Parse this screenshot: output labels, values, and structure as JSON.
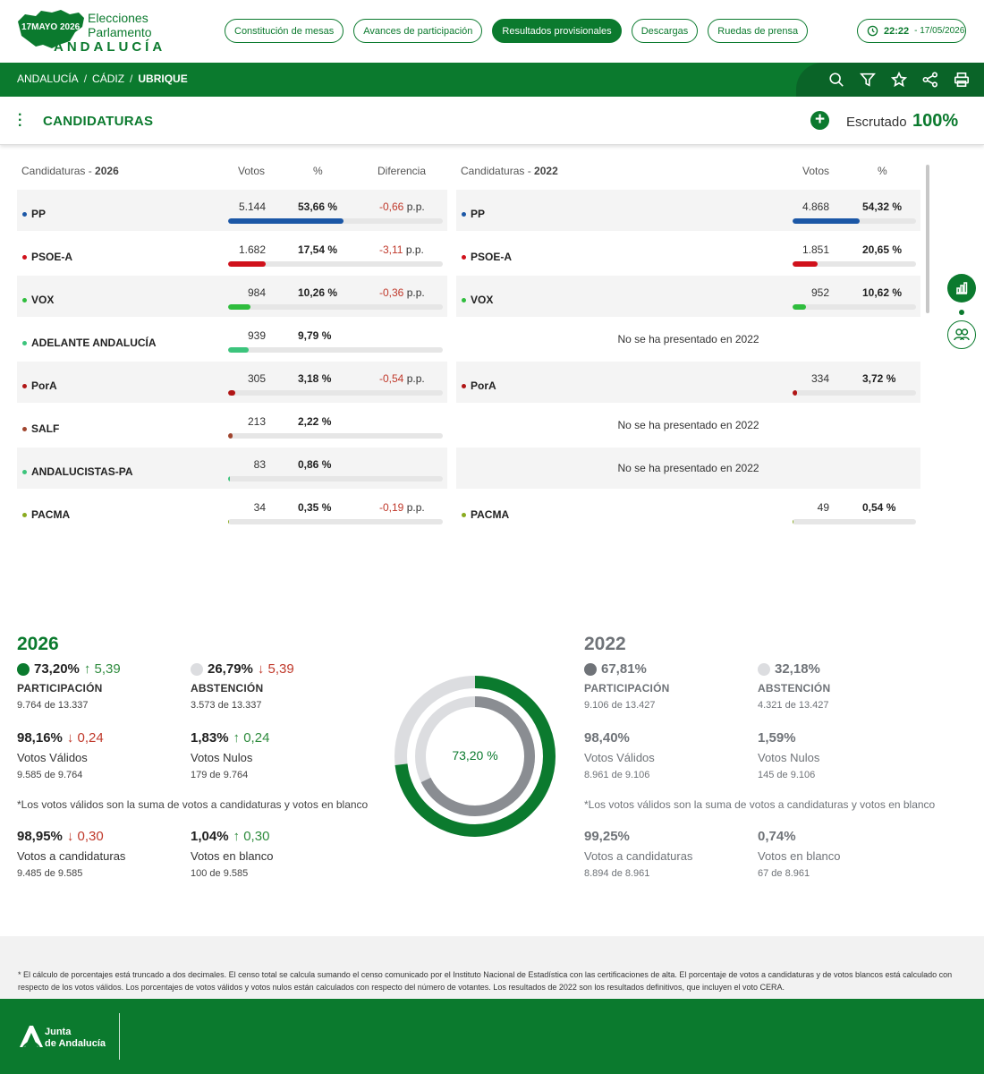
{
  "header": {
    "logo_date": "17MAYO 2026",
    "logo_line1": "Elecciones",
    "logo_line2": "Parlamento",
    "logo_line3": "ANDALUCÍA",
    "nav": [
      "Constitución de mesas",
      "Avances de participación",
      "Resultados provisionales",
      "Descargas",
      "Ruedas de prensa"
    ],
    "active_nav": "Resultados provisionales",
    "clock_time": "22:22",
    "clock_date": "- 17/05/2026"
  },
  "breadcrumb": {
    "items": [
      "ANDALUCÍA",
      "CÁDIZ",
      "UBRIQUE"
    ],
    "sep": "/"
  },
  "toolbar_icons": [
    "search-icon",
    "filter-icon",
    "star-icon",
    "share-icon",
    "print-icon"
  ],
  "section": {
    "title": "CANDIDATURAS",
    "scrutinized_label": "Escrutado",
    "scrutinized_value": "100%"
  },
  "table2026": {
    "header_label": "Candidaturas - ",
    "header_year": "2026",
    "col_votes": "Votos",
    "col_pct": "%",
    "col_diff": "Diferencia",
    "rows": [
      {
        "party": "PP",
        "color": "#1b57a6",
        "votes": "5.144",
        "pct": "53,66 %",
        "fraction": 0.5366,
        "diff": "-0,66",
        "diff_unit": "p.p."
      },
      {
        "party": "PSOE-A",
        "color": "#d0111b",
        "votes": "1.682",
        "pct": "17,54 %",
        "fraction": 0.1754,
        "diff": "-3,11",
        "diff_unit": "p.p."
      },
      {
        "party": "VOX",
        "color": "#2fbd3d",
        "votes": "984",
        "pct": "10,26 %",
        "fraction": 0.1026,
        "diff": "-0,36",
        "diff_unit": "p.p."
      },
      {
        "party": "ADELANTE ANDALUCÍA",
        "color": "#3cc47c",
        "votes": "939",
        "pct": "9,79 %",
        "fraction": 0.0979,
        "diff": "",
        "diff_unit": ""
      },
      {
        "party": "PorA",
        "color": "#b01515",
        "votes": "305",
        "pct": "3,18 %",
        "fraction": 0.0318,
        "diff": "-0,54",
        "diff_unit": "p.p."
      },
      {
        "party": "SALF",
        "color": "#a0452e",
        "votes": "213",
        "pct": "2,22 %",
        "fraction": 0.0222,
        "diff": "",
        "diff_unit": ""
      },
      {
        "party": "ANDALUCISTAS-PA",
        "color": "#3cc47c",
        "votes": "83",
        "pct": "0,86 %",
        "fraction": 0.0086,
        "diff": "",
        "diff_unit": ""
      },
      {
        "party": "PACMA",
        "color": "#8aab1f",
        "votes": "34",
        "pct": "0,35 %",
        "fraction": 0.0035,
        "diff": "-0,19",
        "diff_unit": "p.p."
      }
    ]
  },
  "table2022": {
    "header_label": "Candidaturas - ",
    "header_year": "2022",
    "col_votes": "Votos",
    "col_pct": "%",
    "not_presented": "No se ha presentado en 2022",
    "rows": [
      {
        "party": "PP",
        "color": "#1b57a6",
        "votes": "4.868",
        "pct": "54,32 %",
        "fraction": 0.5432,
        "present": true
      },
      {
        "party": "PSOE-A",
        "color": "#d0111b",
        "votes": "1.851",
        "pct": "20,65 %",
        "fraction": 0.2065,
        "present": true
      },
      {
        "party": "VOX",
        "color": "#2fbd3d",
        "votes": "952",
        "pct": "10,62 %",
        "fraction": 0.1062,
        "present": true
      },
      {
        "party": "",
        "present": false
      },
      {
        "party": "PorA",
        "color": "#b01515",
        "votes": "334",
        "pct": "3,72 %",
        "fraction": 0.0372,
        "present": true
      },
      {
        "party": "",
        "present": false
      },
      {
        "party": "",
        "present": false
      },
      {
        "party": "PACMA",
        "color": "#8aab1f",
        "votes": "49",
        "pct": "0,54 %",
        "fraction": 0.0054,
        "present": true
      }
    ]
  },
  "side_icons": [
    "bar-chart-icon",
    "group-icon"
  ],
  "stats2026": {
    "year": "2026",
    "participation": {
      "pct": "73,20%",
      "delta": "↑ 5,39",
      "label": "PARTICIPACIÓN",
      "detail": "9.764 de 13.337"
    },
    "abstention": {
      "pct": "26,79%",
      "delta": "↓ 5,39",
      "label": "ABSTENCIÓN",
      "detail": "3.573 de 13.337"
    },
    "valid": {
      "pct": "98,16%",
      "delta": "↓ 0,24",
      "label": "Votos Válidos",
      "detail": "9.585 de 9.764"
    },
    "null": {
      "pct": "1,83%",
      "delta": "↑ 0,24",
      "label": "Votos Nulos",
      "detail": "179 de 9.764"
    },
    "note": "*Los votos válidos son la suma de votos a candidaturas y votos en blanco",
    "candidates": {
      "pct": "98,95%",
      "delta": "↓ 0,30",
      "label": "Votos a candidaturas",
      "detail": "9.485 de 9.585"
    },
    "blank": {
      "pct": "1,04%",
      "delta": "↑ 0,30",
      "label": "Votos en blanco",
      "detail": "100 de 9.585"
    }
  },
  "stats2022": {
    "year": "2022",
    "participation": {
      "pct": "67,81%",
      "label": "PARTICIPACIÓN",
      "detail": "9.106 de 13.427"
    },
    "abstention": {
      "pct": "32,18%",
      "label": "ABSTENCIÓN",
      "detail": "4.321 de 13.427"
    },
    "valid": {
      "pct": "98,40%",
      "label": "Votos Válidos",
      "detail": "8.961 de 9.106"
    },
    "null": {
      "pct": "1,59%",
      "label": "Votos Nulos",
      "detail": "145 de 9.106"
    },
    "note": "*Los votos válidos son la suma de votos a candidaturas y votos en blanco",
    "candidates": {
      "pct": "99,25%",
      "label": "Votos a candidaturas",
      "detail": "8.894 de 8.961"
    },
    "blank": {
      "pct": "0,74%",
      "label": "Votos en blanco",
      "detail": "67 de 8.961"
    }
  },
  "donut": {
    "label": "73,20 %",
    "outer_fraction": 0.732,
    "inner_fraction": 0.6781,
    "outer_color": "#0b7a2e",
    "inner_color": "#8a8d92",
    "track_color": "#dcdde0"
  },
  "footnote": "* El cálculo de porcentajes está truncado a dos decimales. El censo total se calcula sumando el censo comunicado por el Instituto Nacional de Estadística con las certificaciones de alta. El porcentaje de votos a candidaturas y de votos blancos está calculado con respecto de los votos válidos. Los porcentajes de votos válidos y votos nulos están calculados con respecto del número de votantes. Los resultados de 2022 son los resultados definitivos, que incluyen el voto CERA.",
  "footer": {
    "line1": "Junta",
    "line2": "de Andalucía"
  },
  "colors": {
    "brand": "#0b7a2e",
    "negative": "#c0392b",
    "positive": "#2e8b3d",
    "gray": "#6f7378"
  }
}
